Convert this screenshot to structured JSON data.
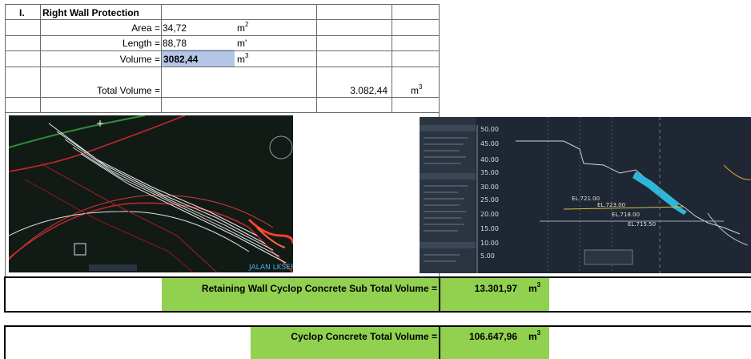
{
  "section": {
    "number": "I.",
    "title": "Right Wall Protection",
    "rows": [
      {
        "label": "Area =",
        "value": "34,72",
        "unit": "m",
        "unit_sup": "2"
      },
      {
        "label": "Length =",
        "value": "88,78",
        "unit": "m'",
        "unit_sup": ""
      },
      {
        "label": "Volume =",
        "value": "3082,44",
        "unit": "m",
        "unit_sup": "3"
      }
    ],
    "total": {
      "label": "Total Volume =",
      "value": "3.082,44",
      "unit": "m",
      "unit_sup": "3"
    }
  },
  "cad_right": {
    "elevations": [
      "50.00",
      "45.00",
      "40.00",
      "35.00",
      "30.00",
      "25.00",
      "20.00",
      "15.00",
      "10.00",
      "5.00"
    ],
    "annotations": [
      "EL.721.00",
      "EL.723.00",
      "EL.718.00",
      "EL.715.50"
    ]
  },
  "subtotal": {
    "label": "Retaining Wall Cyclop Concrete Sub Total Volume =",
    "value": "13.301,97",
    "unit": "m",
    "unit_sup": "3"
  },
  "total": {
    "label": "Cyclop Concrete Total  Volume =",
    "value": "106.647,96",
    "unit": "m",
    "unit_sup": "3"
  },
  "colors": {
    "green": "#92d050",
    "blue_highlight": "#b4c6e7",
    "cad_background": "#1e2733",
    "cad_slope": "#3ab8d8"
  }
}
